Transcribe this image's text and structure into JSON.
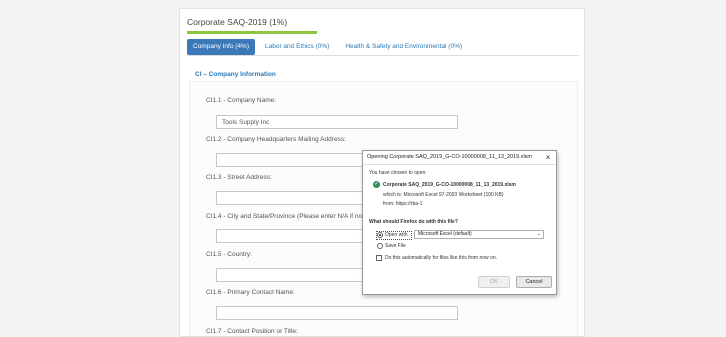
{
  "page": {
    "title": "Corporate SAQ-2019 (1%)",
    "progress_fraction": 0.01
  },
  "tabs": [
    {
      "label": "Company Info (4%)",
      "active": true
    },
    {
      "label": "Labor and Ethics (0%)",
      "active": false
    },
    {
      "label": "Health & Safety and Environmental (0%)",
      "active": false
    }
  ],
  "section": {
    "title": "CI – Company Information"
  },
  "questions": [
    {
      "label": "CI1.1 - Company Name:",
      "value": "Tools Supply Inc"
    },
    {
      "label": "CI1.2 - Company Headquarters Mailing Address:",
      "value": ""
    },
    {
      "label": "CI1.3 - Street Address:",
      "value": ""
    },
    {
      "label": "CI1.4 - City and State/Province (Please enter N/A if not applicab",
      "value": ""
    },
    {
      "label": "CI1.5 - Country:",
      "value": ""
    },
    {
      "label": "CI1.6 - Primary Contact Name:",
      "value": ""
    },
    {
      "label": "CI1.7 - Contact Position or Title:"
    }
  ],
  "dialog": {
    "title": "Opening Corporate SAQ_2019_G-CO-10000008_11_13_2019.xlsm",
    "close_glyph": "×",
    "chosen_text": "You have chosen to open:",
    "file_name": "Corporate SAQ_2019_G-CO-10000008_11_13_2019.xlsm",
    "which_is": "which is:  Microsoft Excel 97-2003 Worksheet (100 KB)",
    "from": "from:  https://rba-1",
    "question": "What should Firefox do with this file?",
    "open_with_label": "Open with",
    "open_with_selected": "Microsoft Excel (default)",
    "save_file_label": "Save File",
    "auto_label": "Do this automatically for files like this from now on.",
    "ok_label": "OK",
    "cancel_label": "Cancel",
    "file_icon_glyph": "✓",
    "dropdown_glyph": "⌄"
  },
  "colors": {
    "accent": "#3a78b8",
    "progress": "#8cc63f",
    "link": "#2a7ab8"
  }
}
